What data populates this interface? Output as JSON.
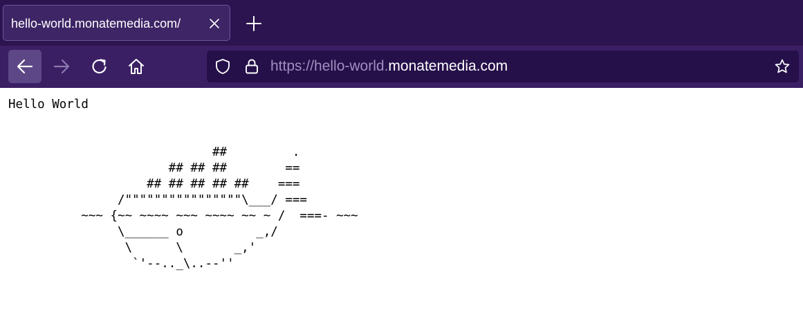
{
  "browser": {
    "tab": {
      "title": "hello-world.monatemedia.com/"
    },
    "url": {
      "prefix": "https://hello-world.",
      "domain": "monatemedia.com"
    },
    "colors": {
      "tabbar_bg": "#2c1450",
      "navbar_bg": "#3b1f65",
      "urlbar_bg": "#25104a"
    }
  },
  "page": {
    "text": "Hello World\n\n\n                            ##         .\n                      ## ## ##        ==\n                   ## ## ## ## ##    ===\n               /\"\"\"\"\"\"\"\"\"\"\"\"\"\"\"\"\\___/ ===\n          ~~~ {~~ ~~~~ ~~~ ~~~~ ~~ ~ /  ===- ~~~\n               \\______ o          _,/\n                \\      \\       _,'\n                 `'--.._\\..--''"
  }
}
